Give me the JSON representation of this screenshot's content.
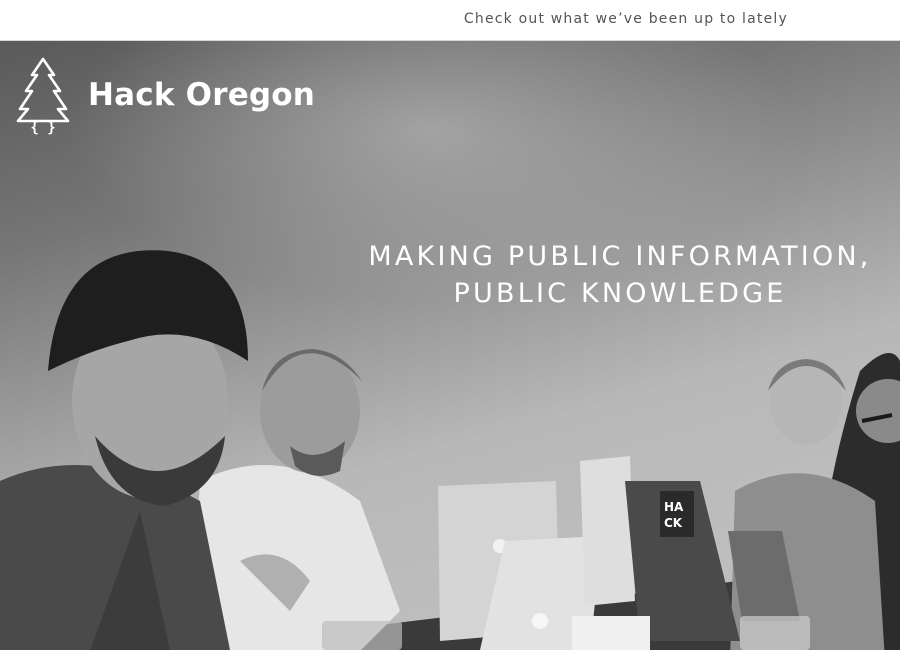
{
  "topbar": {
    "link_text": "Check out what we’ve been up to lately"
  },
  "header": {
    "logo_icon": "tree-braces-icon",
    "brand_name": "Hack Oregon"
  },
  "hero": {
    "tagline_line1": "MAKING PUBLIC INFORMATION,",
    "tagline_line2": "PUBLIC KNOWLEDGE",
    "photo_alt": "People working on laptops around a table",
    "laptop_sticker": "HA CK"
  },
  "colors": {
    "topbar_bg": "#ffffff",
    "topbar_text": "#555555",
    "hero_text": "#ffffff"
  }
}
